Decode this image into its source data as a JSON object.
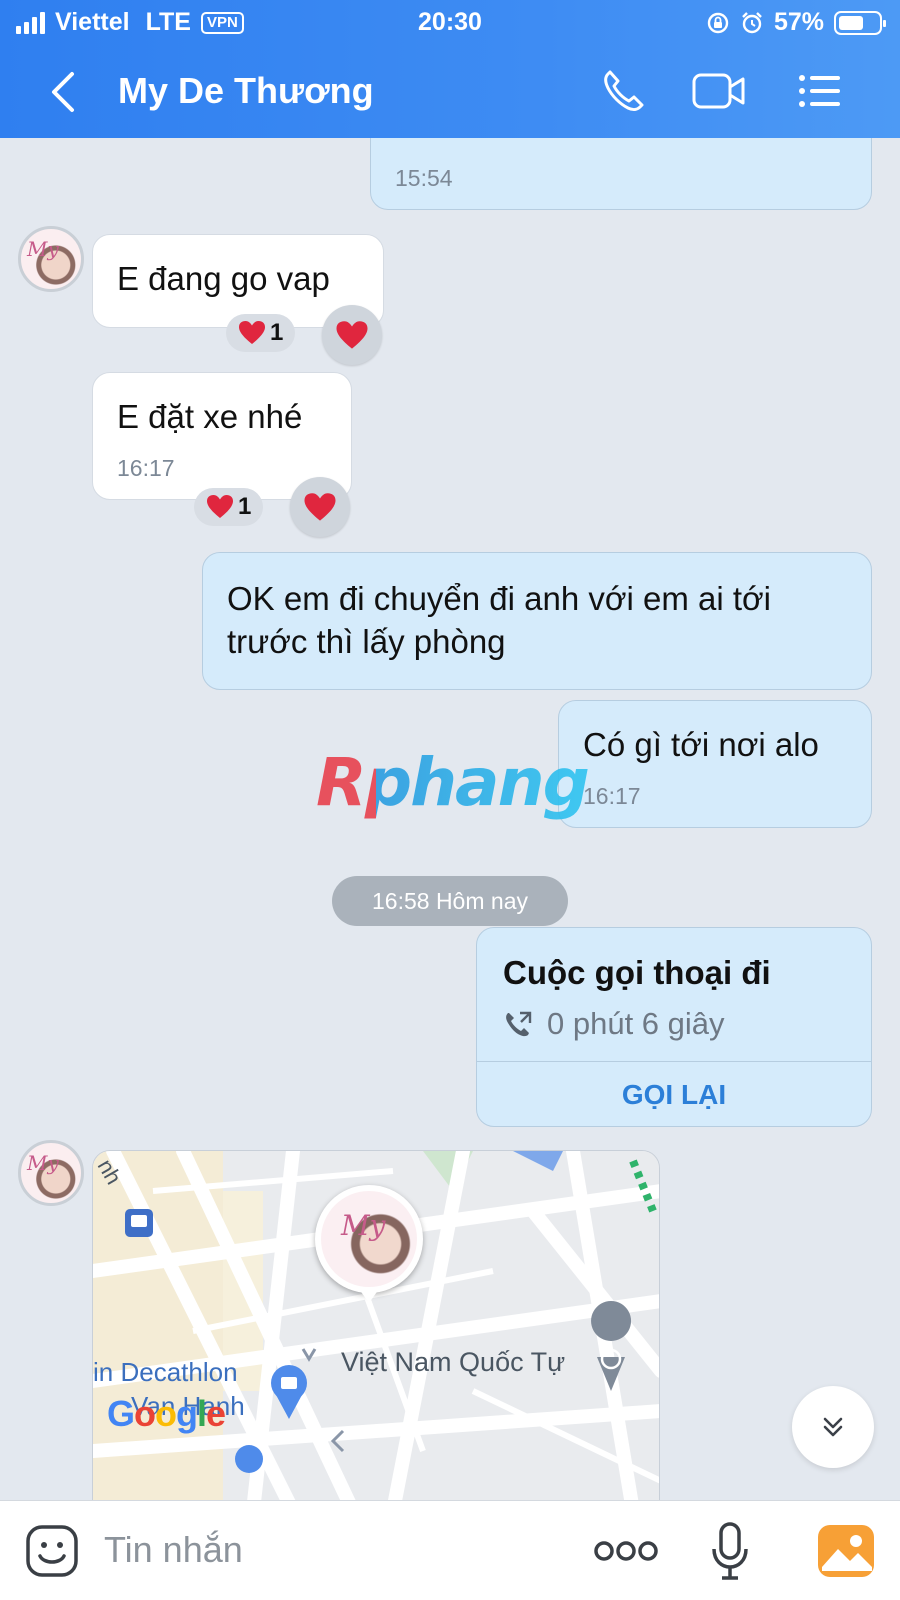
{
  "status_bar": {
    "carrier": "Viettel",
    "network": "LTE",
    "vpn": "VPN",
    "time": "20:30",
    "battery": "57%"
  },
  "header": {
    "title": "My De Thương",
    "icons": [
      "back-icon",
      "phone-icon",
      "video-icon",
      "menu-list-icon"
    ]
  },
  "messages": {
    "m0_time": "15:54",
    "m1_text": "E đang go vap",
    "m1_reaction_count": "1",
    "m2_text": "E đặt xe nhé",
    "m2_time": "16:17",
    "m2_reaction_count": "1",
    "m3_text_line1": "OK em đi chuyển đi anh với em ai tới",
    "m3_text_line2": "trước thì lấy phòng",
    "m4_text": "Có gì tới nơi alo",
    "m4_time": "16:17"
  },
  "divider": {
    "date_label": "16:58 Hôm nay"
  },
  "call_card": {
    "title": "Cuộc gọi thoại đi",
    "duration": "0 phút 6 giây",
    "action": "GỌI LẠI"
  },
  "map": {
    "place_1": "Việt Nam Quốc Tự",
    "place_2_line1": "in Decathlon",
    "place_2_line2": "Van Hanh",
    "street_fragment": "nh",
    "provider": "Google"
  },
  "watermark": "Rphang",
  "avatar_text": "My",
  "input": {
    "placeholder": "Tin nhắn"
  },
  "colors": {
    "header": "#3e8cf3",
    "incoming_bubble": "#ffffff",
    "outgoing_bubble": "#d5ebfb",
    "link": "#2c7fd8",
    "heart": "#e0263e"
  }
}
